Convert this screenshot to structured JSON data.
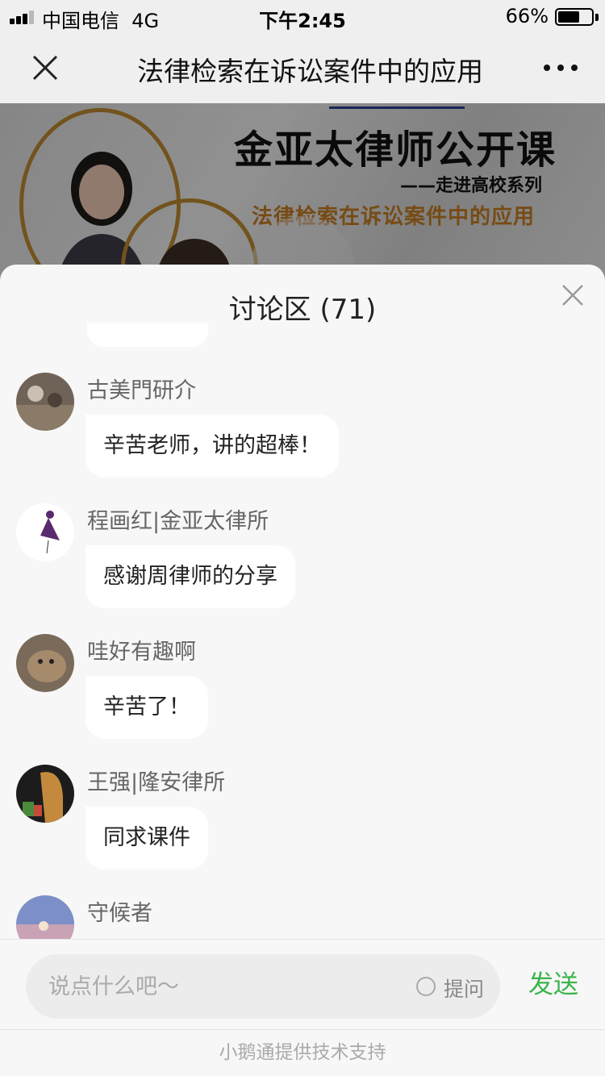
{
  "status_bar": {
    "carrier": "中国电信",
    "network": "4G",
    "time": "下午2:45",
    "battery": "66%",
    "battery_level": 0.66
  },
  "nav": {
    "title": "法律检索在诉讼案件中的应用",
    "close_icon": "close-icon",
    "more_icon": "more-icon"
  },
  "banner": {
    "title": "金亚太律师公开课",
    "subtitle": "——走进高校系列",
    "topic": "法律检索在诉讼案件中的应用"
  },
  "discussion": {
    "title": "讨论区 (71)",
    "messages": [
      {
        "user": "古美門研介",
        "text": "辛苦老师，讲的超棒！"
      },
      {
        "user": "程画红|金亚太律所",
        "text": "感谢周律师的分享"
      },
      {
        "user": "哇好有趣啊",
        "text": "辛苦了！"
      },
      {
        "user": "王强|隆安律所",
        "text": "同求课件"
      },
      {
        "user": "守候者",
        "text": ""
      }
    ]
  },
  "input": {
    "placeholder": "说点什么吧～",
    "ask_label": "提问",
    "send_label": "发送"
  },
  "footer": {
    "text": "小鹅通提供技术支持"
  },
  "colors": {
    "send": "#3bb44a",
    "banner_gold": "#b8862f",
    "banner_topic": "#c07a22"
  }
}
